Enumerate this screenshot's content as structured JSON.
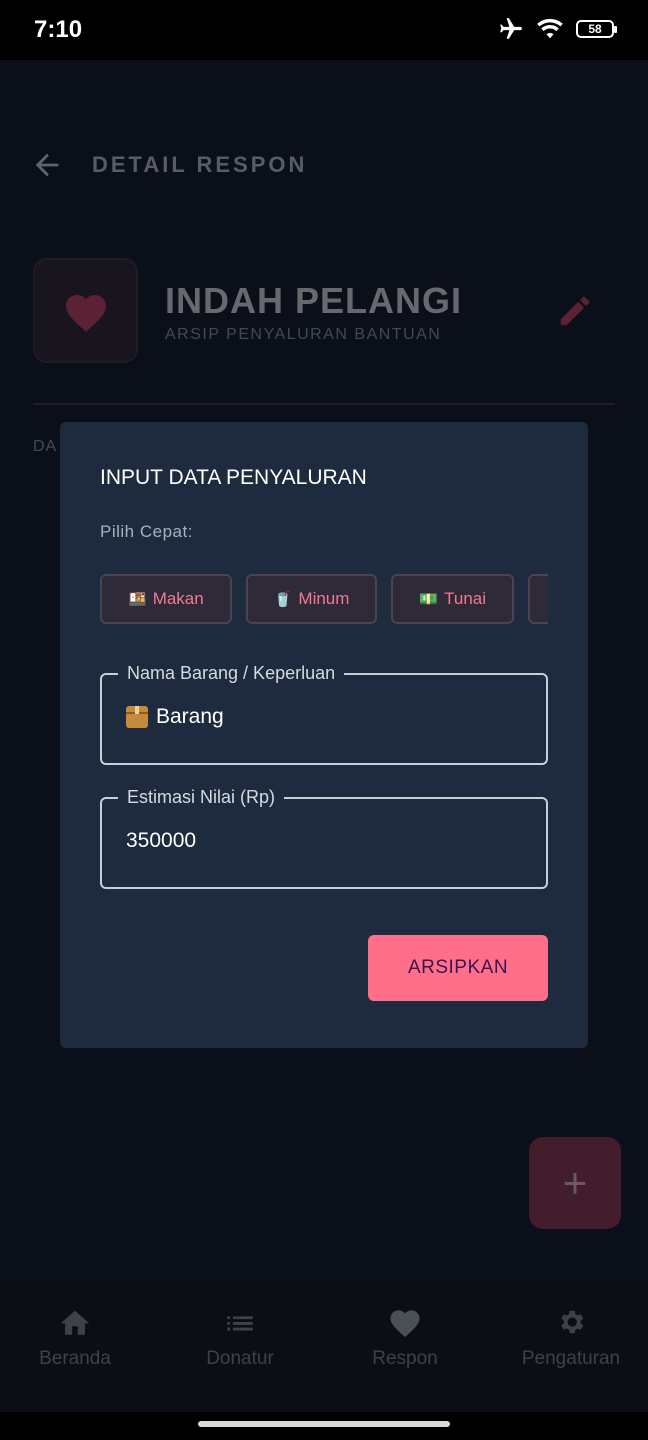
{
  "status_bar": {
    "time": "7:10",
    "battery": "58",
    "icons": [
      "airplane-icon",
      "wifi-icon",
      "battery-icon"
    ]
  },
  "header": {
    "title": "DETAIL RESPON"
  },
  "profile": {
    "name": "INDAH PELANGI",
    "subtitle": "ARSIP PENYALURAN BANTUAN"
  },
  "background_label": "DA",
  "dialog": {
    "title": "INPUT DATA PENYALURAN",
    "quick_label": "Pilih Cepat:",
    "chips": [
      {
        "icon": "🍱",
        "label": "Makan"
      },
      {
        "icon": "🥤",
        "label": "Minum"
      },
      {
        "icon": "💵",
        "label": "Tunai"
      },
      {
        "icon": "",
        "label": ""
      }
    ],
    "item_field": {
      "label": "Nama Barang / Keperluan",
      "value": "Barang"
    },
    "value_field": {
      "label": "Estimasi Nilai (Rp)",
      "value": "350000"
    },
    "submit_label": "ARSIPKAN"
  },
  "fab": {
    "icon": "+"
  },
  "bottom_nav": [
    {
      "label": "Beranda",
      "icon": "home-icon"
    },
    {
      "label": "Donatur",
      "icon": "list-icon"
    },
    {
      "label": "Respon",
      "icon": "heart-icon"
    },
    {
      "label": "Pengaturan",
      "icon": "gear-icon"
    }
  ],
  "colors": {
    "accent": "#ff6f8a",
    "dialog_bg": "#1e2a3d",
    "page_bg": "#0b0f19"
  }
}
